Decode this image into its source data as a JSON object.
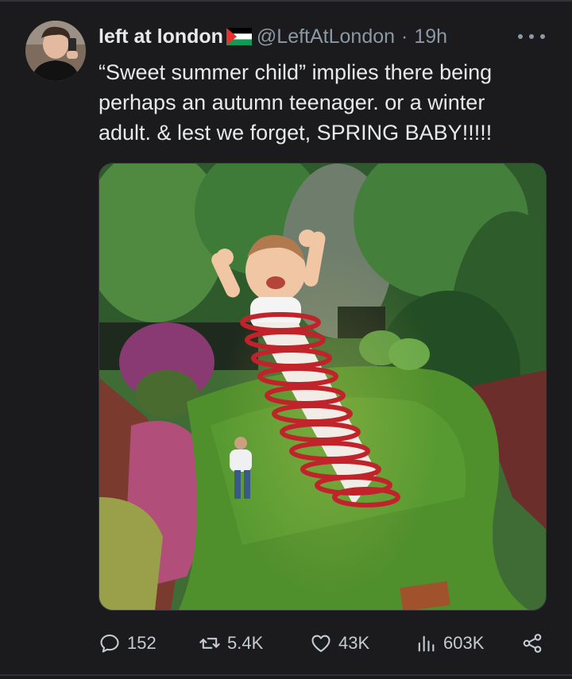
{
  "author": {
    "display_name": "left at london",
    "handle": "@LeftAtLondon",
    "separator": "·",
    "time": "19h"
  },
  "tweet": {
    "text": "“Sweet summer child” implies there being\nperhaps an autumn teenager. or a winter\nadult. & lest we forget, SPRING BABY!!!!!"
  },
  "actions": {
    "replies": "152",
    "reposts": "5.4K",
    "likes": "43K",
    "views": "603K"
  },
  "icons": {
    "more": "more-horizontal-icon",
    "reply": "reply-bubble-icon",
    "repost": "repost-arrows-icon",
    "like": "heart-icon",
    "views": "bar-chart-icon",
    "share": "share-icon",
    "flag": "palestine-flag-icon"
  },
  "colors": {
    "background": "#1b1b1d",
    "text_primary": "#e7e9ea",
    "text_secondary": "#8b98a5",
    "divider": "#2f3336"
  }
}
